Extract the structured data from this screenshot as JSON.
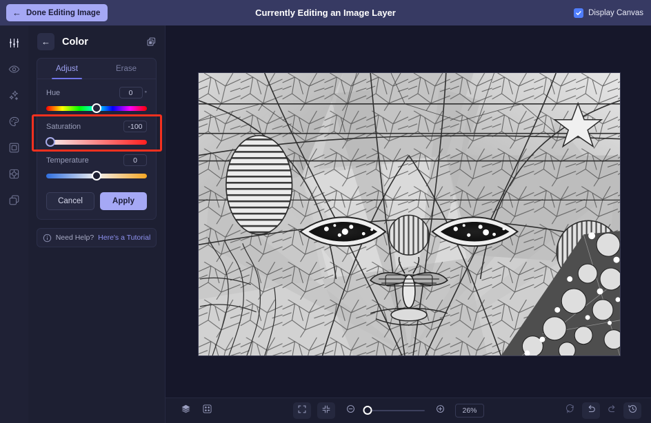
{
  "topbar": {
    "done_label": "Done Editing Image",
    "back_arrow": "←",
    "title": "Currently Editing an Image Layer",
    "display_canvas_label": "Display Canvas",
    "display_canvas_checked": true,
    "accent_button_bg": "#a5a8f5",
    "bar_bg": "#373a63",
    "checkbox_color": "#4f7dfb"
  },
  "rail": {
    "items": [
      {
        "icon": "adjustments-icon",
        "name": "sidebar-item-adjust",
        "active": true
      },
      {
        "icon": "eye-icon",
        "name": "sidebar-item-visibility",
        "active": false
      },
      {
        "icon": "sparkles-icon",
        "name": "sidebar-item-effects",
        "active": false
      },
      {
        "icon": "palette-icon",
        "name": "sidebar-item-color",
        "active": false
      },
      {
        "icon": "frame-icon",
        "name": "sidebar-item-frame",
        "active": false
      },
      {
        "icon": "crop-rotate-icon",
        "name": "sidebar-item-transform",
        "active": false
      },
      {
        "icon": "layers-copy-icon",
        "name": "sidebar-item-layers",
        "active": false
      }
    ]
  },
  "panel": {
    "back_arrow": "←",
    "title": "Color",
    "duplicate_icon": "duplicate-layers-icon",
    "tabs": [
      {
        "label": "Adjust",
        "active": true
      },
      {
        "label": "Erase",
        "active": false
      }
    ],
    "sliders": [
      {
        "label": "Hue",
        "value": "0",
        "unit": "°",
        "thumb_percent": 50,
        "track": "rainbow",
        "highlighted": false
      },
      {
        "label": "Saturation",
        "value": "-100",
        "unit": "",
        "thumb_percent": 4,
        "track": "saturation",
        "highlighted": true
      },
      {
        "label": "Temperature",
        "value": "0",
        "unit": "",
        "thumb_percent": 50,
        "track": "temperature",
        "highlighted": false
      }
    ],
    "highlight_color": "#f4311f",
    "cancel_label": "Cancel",
    "apply_label": "Apply",
    "help": {
      "icon": "info-icon",
      "text": "Need Help?",
      "link": "Here's a Tutorial",
      "link_color": "#8e92f0"
    }
  },
  "bottombar": {
    "left_tools": [
      {
        "icon": "layers-stack-icon",
        "name": "layers-button"
      },
      {
        "icon": "grid-icon",
        "name": "grid-button"
      }
    ],
    "center_tools": [
      {
        "icon": "fullscreen-icon",
        "name": "fullscreen-button",
        "boxed": true
      },
      {
        "icon": "fit-screen-icon",
        "name": "fit-to-screen-button",
        "boxed": true
      }
    ],
    "zoom_out_icon": "minus-circle-icon",
    "zoom_in_icon": "plus-circle-icon",
    "zoom_percent": "26%",
    "zoom_thumb_percent": 3,
    "right_tools": [
      {
        "icon": "reset-icon",
        "name": "reset-button",
        "dim": true,
        "boxed": false
      },
      {
        "icon": "undo-icon",
        "name": "undo-button",
        "dim": false,
        "boxed": true
      },
      {
        "icon": "redo-icon",
        "name": "redo-button",
        "dim": true,
        "boxed": false
      },
      {
        "icon": "history-icon",
        "name": "history-button",
        "dim": false,
        "boxed": true
      }
    ]
  },
  "canvas": {
    "description": "Grayscale mosaic stained-glass artwork of a stylized face",
    "zoom_label": "26%"
  }
}
